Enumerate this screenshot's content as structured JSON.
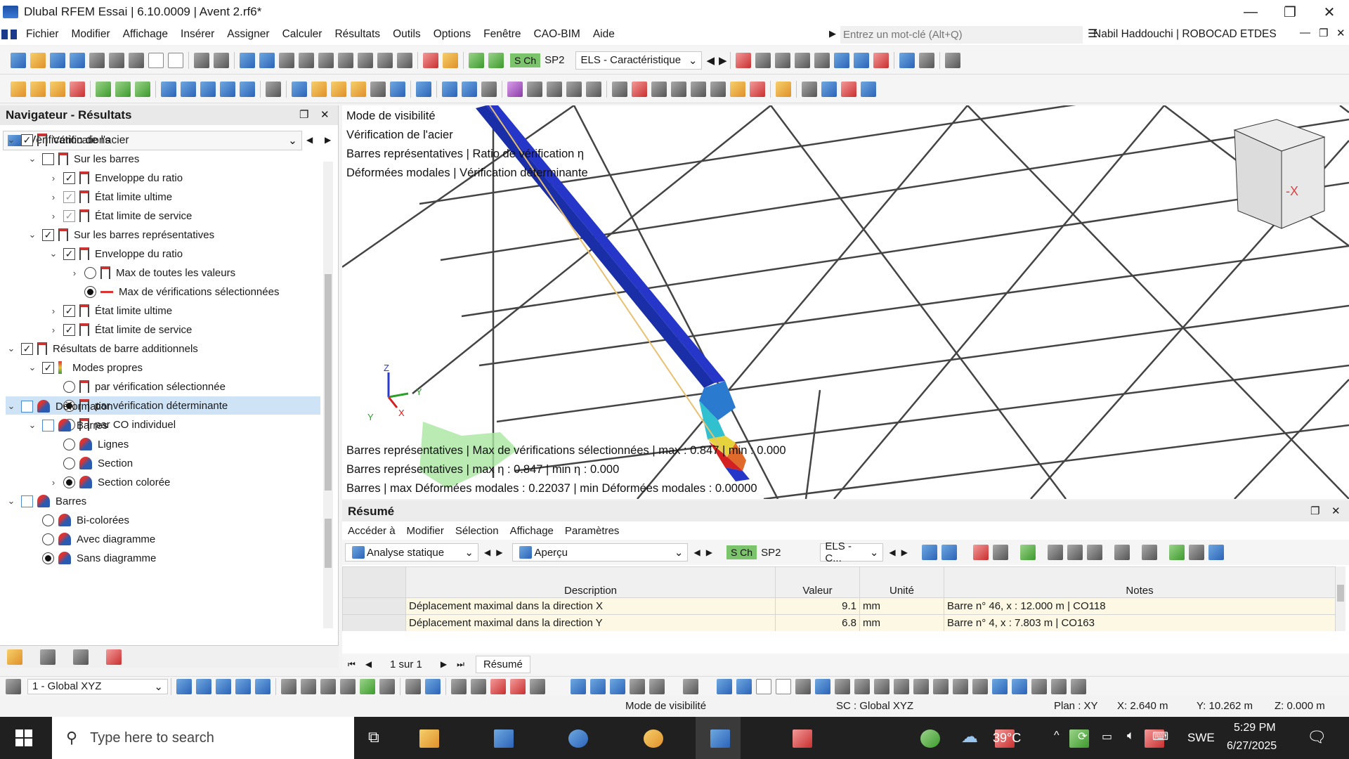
{
  "window": {
    "title": "Dlubal RFEM Essai | 6.10.0009 | Avent 2.rf6*",
    "minimize": "—",
    "restore": "❐",
    "close": "✕"
  },
  "menu": [
    "Fichier",
    "Modifier",
    "Affichage",
    "Insérer",
    "Assigner",
    "Calculer",
    "Résultats",
    "Outils",
    "Options",
    "Fenêtre",
    "CAO-BIM",
    "Aide"
  ],
  "search": {
    "placeholder": "Entrez un mot-clé (Alt+Q)"
  },
  "user": "Nabil Haddouchi | ROBOCAD ETDES",
  "toolbar": {
    "sch": "S Ch",
    "sp2": "SP2",
    "combo": "ELS - Caractéristique"
  },
  "navigator": {
    "title": "Navigateur - Résultats",
    "combo": "Vérification de l'acier",
    "tree1": [
      {
        "label": "Vérifications",
        "state": "✓",
        "type": "cb",
        "indent": 0,
        "chev": "v"
      },
      {
        "label": "Sur les barres",
        "state": "",
        "type": "cb",
        "indent": 1,
        "chev": "v"
      },
      {
        "label": "Enveloppe du ratio",
        "state": "✓",
        "type": "cb",
        "indent": 2,
        "chev": ">"
      },
      {
        "label": "État limite ultime",
        "state": "✓",
        "type": "cbdim",
        "indent": 2,
        "chev": ">"
      },
      {
        "label": "État limite de service",
        "state": "✓",
        "type": "cbdim",
        "indent": 2,
        "chev": ">"
      },
      {
        "label": "Sur les barres représentatives",
        "state": "✓",
        "type": "cb",
        "indent": 1,
        "chev": "v"
      },
      {
        "label": "Enveloppe du ratio",
        "state": "✓",
        "type": "cb",
        "indent": 2,
        "chev": "v"
      },
      {
        "label": "Max de toutes les valeurs",
        "state": "",
        "type": "rd",
        "indent": 3,
        "chev": ">"
      },
      {
        "label": "Max de vérifications sélectionnées",
        "state": "on",
        "type": "rdline",
        "indent": 3,
        "chev": ""
      },
      {
        "label": "État limite ultime",
        "state": "✓",
        "type": "cb",
        "indent": 2,
        "chev": ">"
      },
      {
        "label": "État limite de service",
        "state": "✓",
        "type": "cb",
        "indent": 2,
        "chev": ">"
      },
      {
        "label": "Résultats de barre additionnels",
        "state": "✓",
        "type": "cb",
        "indent": 0,
        "chev": "v"
      },
      {
        "label": "Modes propres",
        "state": "✓",
        "type": "cbmodes",
        "indent": 1,
        "chev": "v"
      },
      {
        "label": "par vérification sélectionnée",
        "state": "",
        "type": "rd",
        "indent": 2,
        "chev": ""
      },
      {
        "label": "par vérification déterminante",
        "state": "on",
        "type": "rd",
        "indent": 2,
        "chev": "",
        "selected": true
      },
      {
        "label": "par CO individuel",
        "state": "",
        "type": "rd",
        "indent": 2,
        "chev": ""
      }
    ],
    "tree2": [
      {
        "label": "Déformation",
        "state": "",
        "type": "cbblue",
        "indent": 0,
        "chev": "v"
      },
      {
        "label": "Barres",
        "state": "",
        "type": "cbblue",
        "indent": 1,
        "chev": "v"
      },
      {
        "label": "Lignes",
        "state": "",
        "type": "rd",
        "indent": 2,
        "chev": ""
      },
      {
        "label": "Section",
        "state": "",
        "type": "rd",
        "indent": 2,
        "chev": ""
      },
      {
        "label": "Section colorée",
        "state": "on",
        "type": "rd",
        "indent": 2,
        "chev": ">"
      },
      {
        "label": "Barres",
        "state": "",
        "type": "cbblue",
        "indent": 0,
        "chev": "v"
      },
      {
        "label": "Bi-colorées",
        "state": "",
        "type": "rd",
        "indent": 1,
        "chev": ""
      },
      {
        "label": "Avec diagramme",
        "state": "",
        "type": "rd",
        "indent": 1,
        "chev": ""
      },
      {
        "label": "Sans diagramme",
        "state": "on",
        "type": "rd",
        "indent": 1,
        "chev": ""
      }
    ]
  },
  "viewport": {
    "info": [
      "Mode de visibilité",
      "Vérification de l'acier",
      "Barres représentatives | Ratio de vérification η",
      "Déformées modales | Vérification déterminante"
    ],
    "bottom": [
      "Barres représentatives | Max de vérifications sélectionnées | max  : 0.847 | min  : 0.000",
      "Barres représentatives | max η : 0.847 | min η : 0.000",
      "Barres | max Déformées modales : 0.22037 | min Déformées modales : 0.00000"
    ],
    "axes": {
      "z": "Z",
      "y": "Y",
      "x": "X",
      "y2": "Y"
    },
    "cube": "-X"
  },
  "summary": {
    "title": "Résumé",
    "menu": [
      "Accéder à",
      "Modifier",
      "Sélection",
      "Affichage",
      "Paramètres"
    ],
    "analysis": "Analyse statique",
    "view": "Aperçu",
    "sch": "S Ch",
    "sp2": "SP2",
    "els": "ELS - C...",
    "headers": [
      "Description",
      "Valeur",
      "Unité",
      "Notes"
    ],
    "rows": [
      [
        "Déplacement maximal dans la direction X",
        "9.1",
        "mm",
        "Barre n° 46, x : 12.000 m | CO118"
      ],
      [
        "Déplacement maximal dans la direction Y",
        "6.8",
        "mm",
        "Barre n° 4, x : 7.803 m | CO163"
      ]
    ],
    "pager": "1 sur 1",
    "tab": "Résumé"
  },
  "bottombar": {
    "cs": "1 - Global XYZ"
  },
  "status": {
    "mode": "Mode de visibilité",
    "sc": "SC : Global XYZ",
    "plan": "Plan : XY",
    "x": "X: 2.640 m",
    "y": "Y: 10.262 m",
    "z": "Z: 0.000 m"
  },
  "taskbar": {
    "search": "Type here to search",
    "temp": "39°C",
    "lang": "SWE",
    "time": "5:29 PM",
    "date": "6/27/2025"
  },
  "colors": {
    "accent": "#2b63b8",
    "select": "#cfe3f7",
    "green": "#7cc46b"
  }
}
